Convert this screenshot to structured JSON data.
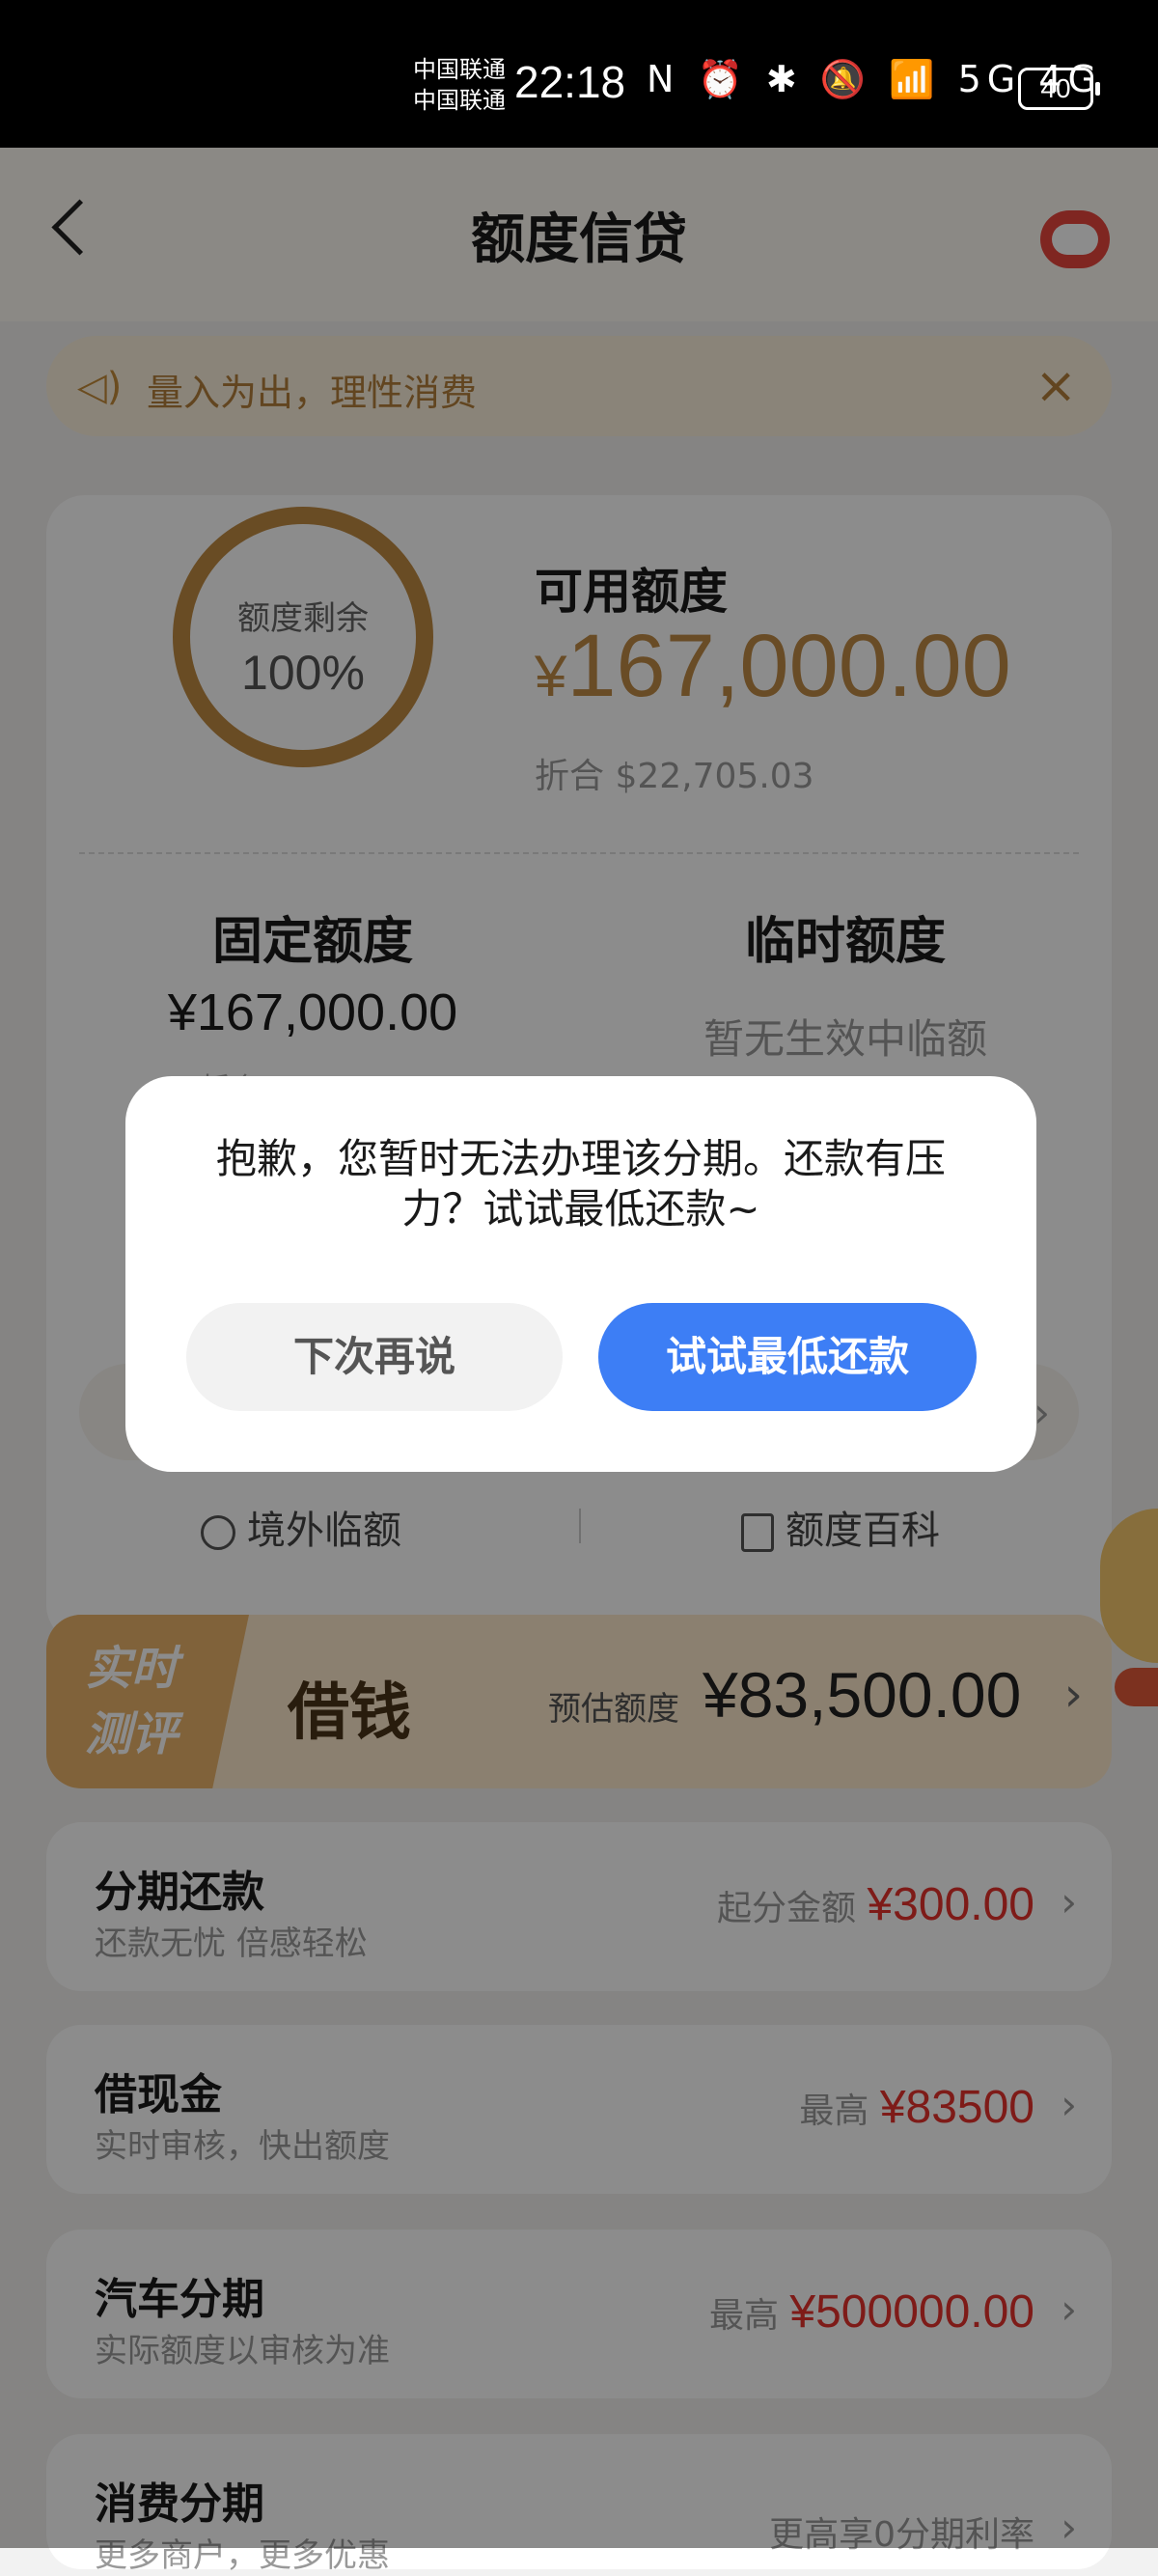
{
  "status_bar": {
    "carrier1": "中国联通",
    "carrier2": "中国联通",
    "time": "22:18",
    "icons": "N ⏰ ✱ 🔕 📶 5G 4G",
    "battery": "40"
  },
  "header": {
    "title": "额度信贷"
  },
  "notice": {
    "text": "量入为出，理性消费"
  },
  "credit": {
    "ring_label": "额度剩余",
    "ring_value": "100%",
    "remaining_fraction": 1.0,
    "available_label": "可用额度",
    "available_currency": "¥",
    "available_value": "167,000.00",
    "available_usd": "折合  $22,705.03",
    "fixed_label": "固定额度",
    "fixed_value": "¥167,000.00",
    "fixed_usd": "折合$22,705.03",
    "temp_label": "临时额度",
    "temp_value": "暂无生效中临额",
    "link_overseas": "境外临额",
    "link_wiki": "额度百科"
  },
  "borrow": {
    "tag": "实时测评",
    "title": "借钱",
    "est_label": "预估额度",
    "est_amount": "¥83,500.00"
  },
  "items": [
    {
      "title": "分期还款",
      "sub": "还款无忧 倍感轻松",
      "right_label": "起分金额",
      "right_value": "¥300.00"
    },
    {
      "title": "借现金",
      "sub": "实时审核，快出额度",
      "right_label": "最高",
      "right_value": "¥83500"
    },
    {
      "title": "汽车分期",
      "sub": "实际额度以审核为准",
      "right_label": "最高",
      "right_value": "¥500000.00"
    },
    {
      "title": "消费分期",
      "sub": "更多商户，更多优惠",
      "right_label": "更高享0分期利率",
      "right_value": ""
    }
  ],
  "dialog": {
    "message": "抱歉，您暂时无法办理该分期。还款有压力？试试最低还款~",
    "cancel_label": "下次再说",
    "confirm_label": "试试最低还款"
  },
  "colors": {
    "accent_gold": "#bf8a46",
    "primary_blue": "#3d7ef5",
    "price_red": "#e5322d"
  }
}
